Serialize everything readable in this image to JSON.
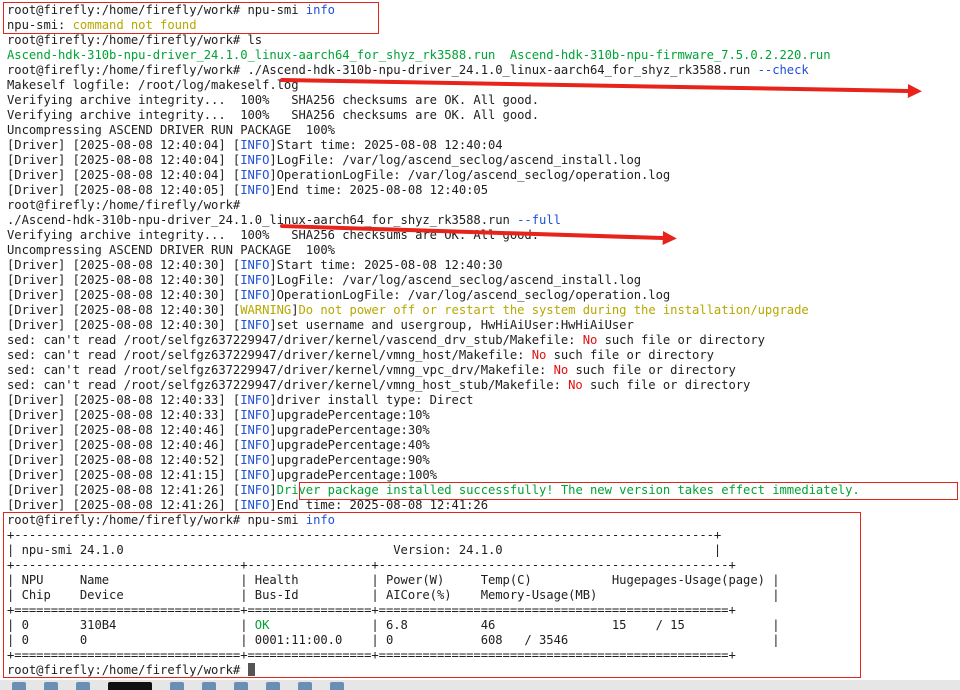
{
  "lines": [
    [
      {
        "t": "root@firefly:/home/firefly/work# npu-smi "
      },
      {
        "t": "info",
        "c": "blue"
      }
    ],
    [
      {
        "t": "npu-smi: "
      },
      {
        "t": "command not found",
        "c": "yellow"
      }
    ],
    [
      {
        "t": "root@firefly:/home/firefly/work# ls"
      }
    ],
    [
      {
        "t": "Ascend-hdk-310b-npu-driver_24.1.0_linux-aarch64_for_shyz_rk3588.run  Ascend-hdk-310b-npu-firmware_7.5.0.2.220.run",
        "c": "green"
      }
    ],
    [
      {
        "t": "root@firefly:/home/firefly/work# ./Ascend-hdk-310b-npu-driver_24.1.0_linux-aarch64_for_shyz_rk3588.run "
      },
      {
        "t": "--check",
        "c": "blue"
      }
    ],
    [
      {
        "t": "Makeself logfile: /root/log/makeself.log"
      }
    ],
    [
      {
        "t": "Verifying archive integrity...  100%   SHA256 checksums are OK. All good."
      }
    ],
    [
      {
        "t": "Verifying archive integrity...  100%   SHA256 checksums are OK. All good."
      }
    ],
    [
      {
        "t": "Uncompressing ASCEND DRIVER RUN PACKAGE  100%"
      }
    ],
    [
      {
        "t": "[Driver] [2025-08-08 12:40:04] ["
      },
      {
        "t": "INFO",
        "c": "blue"
      },
      {
        "t": "]Start time: 2025-08-08 12:40:04"
      }
    ],
    [
      {
        "t": "[Driver] [2025-08-08 12:40:04] ["
      },
      {
        "t": "INFO",
        "c": "blue"
      },
      {
        "t": "]LogFile: /var/log/ascend_seclog/ascend_install.log"
      }
    ],
    [
      {
        "t": "[Driver] [2025-08-08 12:40:04] ["
      },
      {
        "t": "INFO",
        "c": "blue"
      },
      {
        "t": "]OperationLogFile: /var/log/ascend_seclog/operation.log"
      }
    ],
    [
      {
        "t": "[Driver] [2025-08-08 12:40:05] ["
      },
      {
        "t": "INFO",
        "c": "blue"
      },
      {
        "t": "]End time: 2025-08-08 12:40:05"
      }
    ],
    [
      {
        "t": "root@firefly:/home/firefly/work#"
      }
    ],
    [
      {
        "t": "./Ascend-hdk-310b-npu-driver_24.1.0_linux-aarch64_for_shyz_rk3588.run "
      },
      {
        "t": "--full",
        "c": "blue"
      }
    ],
    [
      {
        "t": "Verifying archive integrity...  100%   SHA256 checksums are OK. All good."
      }
    ],
    [
      {
        "t": "Uncompressing ASCEND DRIVER RUN PACKAGE  100%"
      }
    ],
    [
      {
        "t": "[Driver] [2025-08-08 12:40:30] ["
      },
      {
        "t": "INFO",
        "c": "blue"
      },
      {
        "t": "]Start time: 2025-08-08 12:40:30"
      }
    ],
    [
      {
        "t": "[Driver] [2025-08-08 12:40:30] ["
      },
      {
        "t": "INFO",
        "c": "blue"
      },
      {
        "t": "]LogFile: /var/log/ascend_seclog/ascend_install.log"
      }
    ],
    [
      {
        "t": "[Driver] [2025-08-08 12:40:30] ["
      },
      {
        "t": "INFO",
        "c": "blue"
      },
      {
        "t": "]OperationLogFile: /var/log/ascend_seclog/operation.log"
      }
    ],
    [
      {
        "t": "[Driver] [2025-08-08 12:40:30] ["
      },
      {
        "t": "WARNING",
        "c": "yellow"
      },
      {
        "t": "]"
      },
      {
        "t": "Do not power off or restart the system during the installation/upgrade",
        "c": "yellow"
      }
    ],
    [
      {
        "t": "[Driver] [2025-08-08 12:40:30] ["
      },
      {
        "t": "INFO",
        "c": "blue"
      },
      {
        "t": "]set username and usergroup, HwHiAiUser:HwHiAiUser"
      }
    ],
    [
      {
        "t": "sed: can't read /root/selfgz637229947/driver/kernel/vascend_drv_stub/Makefile: "
      },
      {
        "t": "No",
        "c": "red"
      },
      {
        "t": " such file or directory"
      }
    ],
    [
      {
        "t": "sed: can't read /root/selfgz637229947/driver/kernel/vmng_host/Makefile: "
      },
      {
        "t": "No",
        "c": "red"
      },
      {
        "t": " such file or directory"
      }
    ],
    [
      {
        "t": "sed: can't read /root/selfgz637229947/driver/kernel/vmng_vpc_drv/Makefile: "
      },
      {
        "t": "No",
        "c": "red"
      },
      {
        "t": " such file or directory"
      }
    ],
    [
      {
        "t": "sed: can't read /root/selfgz637229947/driver/kernel/vmng_host_stub/Makefile: "
      },
      {
        "t": "No",
        "c": "red"
      },
      {
        "t": " such file or directory"
      }
    ],
    [
      {
        "t": "[Driver] [2025-08-08 12:40:33] ["
      },
      {
        "t": "INFO",
        "c": "blue"
      },
      {
        "t": "]driver install type: Direct"
      }
    ],
    [
      {
        "t": "[Driver] [2025-08-08 12:40:33] ["
      },
      {
        "t": "INFO",
        "c": "blue"
      },
      {
        "t": "]upgradePercentage:10%"
      }
    ],
    [
      {
        "t": "[Driver] [2025-08-08 12:40:46] ["
      },
      {
        "t": "INFO",
        "c": "blue"
      },
      {
        "t": "]upgradePercentage:30%"
      }
    ],
    [
      {
        "t": "[Driver] [2025-08-08 12:40:46] ["
      },
      {
        "t": "INFO",
        "c": "blue"
      },
      {
        "t": "]upgradePercentage:40%"
      }
    ],
    [
      {
        "t": "[Driver] [2025-08-08 12:40:52] ["
      },
      {
        "t": "INFO",
        "c": "blue"
      },
      {
        "t": "]upgradePercentage:90%"
      }
    ],
    [
      {
        "t": "[Driver] [2025-08-08 12:41:15] ["
      },
      {
        "t": "INFO",
        "c": "blue"
      },
      {
        "t": "]upgradePercentage:100%"
      }
    ],
    [
      {
        "t": "[Driver] [2025-08-08 12:41:26] ["
      },
      {
        "t": "INFO",
        "c": "blue"
      },
      {
        "t": "]"
      },
      {
        "t": "Driver package installed successfully! The new version takes effect immediately.",
        "c": "green"
      }
    ],
    [
      {
        "t": "[Driver] [2025-08-08 12:41:26] ["
      },
      {
        "t": "INFO",
        "c": "blue"
      },
      {
        "t": "]End time: 2025-08-08 12:41:26"
      }
    ],
    [
      {
        "t": "root@firefly:/home/firefly/work# npu-smi "
      },
      {
        "t": "info",
        "c": "blue"
      }
    ],
    [
      {
        "t": "+------------------------------------------------------------------------------------------------+"
      }
    ],
    [
      {
        "t": "| npu-smi 24.1.0                                     Version: 24.1.0                             |"
      }
    ],
    [
      {
        "t": "+-------------------------------+-----------------+------------------------------------------------+"
      }
    ],
    [
      {
        "t": "| NPU     Name                  | Health          | Power(W)     Temp(C)           Hugepages-Usage(page) |"
      }
    ],
    [
      {
        "t": "| Chip    Device                | Bus-Id          | AICore(%)    Memory-Usage(MB)                        |"
      }
    ],
    [
      {
        "t": "+===============================+=================+================================================+"
      }
    ],
    [
      {
        "t": "| 0       310B4                 | "
      },
      {
        "t": "OK",
        "c": "green"
      },
      {
        "t": "              | 6.8          46                15    / 15            |"
      }
    ],
    [
      {
        "t": "| 0       0                     | 0001:11:00.0    | 0            608   / 3546                            |"
      }
    ],
    [
      {
        "t": "+===============================+=================+================================================+"
      }
    ],
    [
      {
        "t": "root@firefly:/home/firefly/work# "
      }
    ]
  ]
}
